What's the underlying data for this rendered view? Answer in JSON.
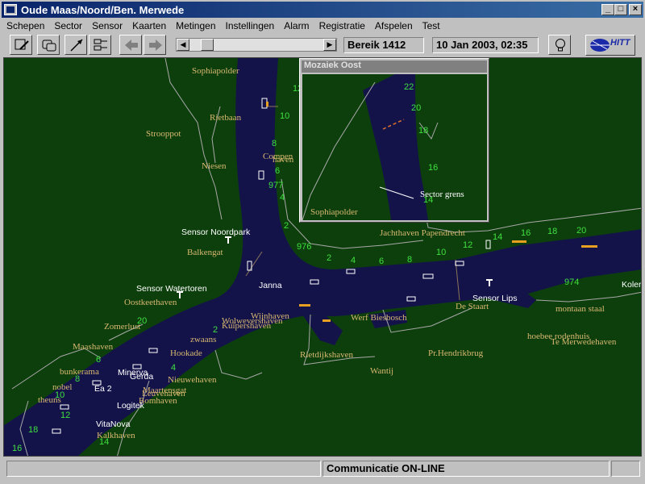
{
  "window": {
    "title": "Oude Maas/Noord/Ben. Merwede"
  },
  "menu": [
    "Schepen",
    "Sector",
    "Sensor",
    "Kaarten",
    "Metingen",
    "Instellingen",
    "Alarm",
    "Registratie",
    "Afspelen",
    "Test"
  ],
  "toolbar": {
    "range_label": "Bereik 1412",
    "datetime": "10 Jan 2003, 02:35",
    "logo_text": "HITT"
  },
  "inset": {
    "title": "Mozaiek Oost",
    "labels": {
      "sophiapolder": "Sophiapolder",
      "sector_grens": "Sector grens"
    },
    "km": [
      "22",
      "20",
      "18",
      "16",
      "14"
    ]
  },
  "map": {
    "places_tan": [
      "Sophiapolder",
      "Rietbaan",
      "Strooppot",
      "Niesen",
      "Compen",
      "haven",
      "Balkengat",
      "Oostkeethaven",
      "Zomerlust",
      "Maashaven",
      "bunkerama",
      "nobel",
      "theuns",
      "Kalkhaven",
      "Hookade",
      "zwaans",
      "Kuipershaven",
      "Wolwevershaven",
      "Wijnhaven",
      "Werf Biesbosch",
      "Rietdijkshaven",
      "Wantij",
      "Pr.Hendrikbrug",
      "De Staart",
      "Jachthaven Papendrecht",
      "montaan staal",
      "hoebee rodenhuis",
      "Te Merwedehaven",
      "Nieuwehaven",
      "Maartensgat",
      "Leuvehaven",
      "Bomhaven"
    ],
    "places_white": [
      "Sensor Noordpark",
      "Sensor Watertoren",
      "Janna",
      "Sensor Lips",
      "Minerva",
      "Gerda",
      "Ea 2",
      "Logitek",
      "VitaNova",
      "Koler"
    ],
    "km_green": [
      "12",
      "10",
      "8",
      "6",
      "4",
      "2",
      "977",
      "976",
      "974",
      "2",
      "4",
      "6",
      "8",
      "10",
      "12",
      "14",
      "16",
      "18",
      "20",
      "2",
      "4",
      "6",
      "8",
      "10",
      "12",
      "14",
      "16",
      "18",
      "20"
    ]
  },
  "status": {
    "left": "",
    "center": "Communicatie ON-LINE",
    "right": ""
  },
  "colors": {
    "water": "#13134a",
    "land": "#0d3f0d",
    "title_bar": "#0a246a",
    "km_text": "#3fe03f",
    "place_text": "#d9b870"
  }
}
